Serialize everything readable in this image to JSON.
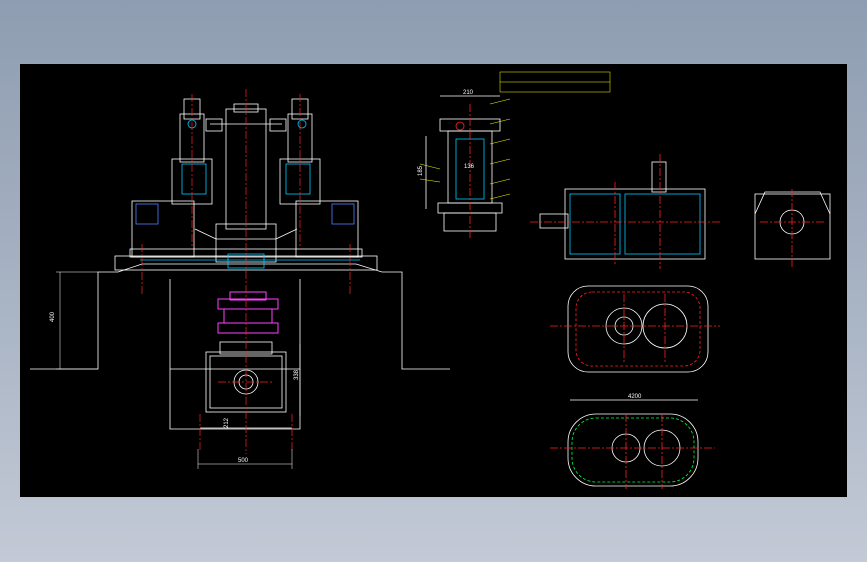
{
  "dimensions": {
    "foundation_height": "400",
    "gearbox_height": "338",
    "gearbox_side": "212",
    "gearbox_width": "500",
    "section_top_width": "210",
    "section_side_height": "185",
    "section_mid_label": "136",
    "top_right_width": "4200"
  },
  "colors": {
    "background_frame": "#9aa6b8",
    "drawing_area": "#000000",
    "outline": "#ffffff",
    "center_line": "#ff2020",
    "dimension": "#ffffff",
    "annotation": "#ffff00",
    "hidden": "#00c8ff",
    "coupling": "#ff40ff",
    "accent_green": "#00ff40"
  }
}
